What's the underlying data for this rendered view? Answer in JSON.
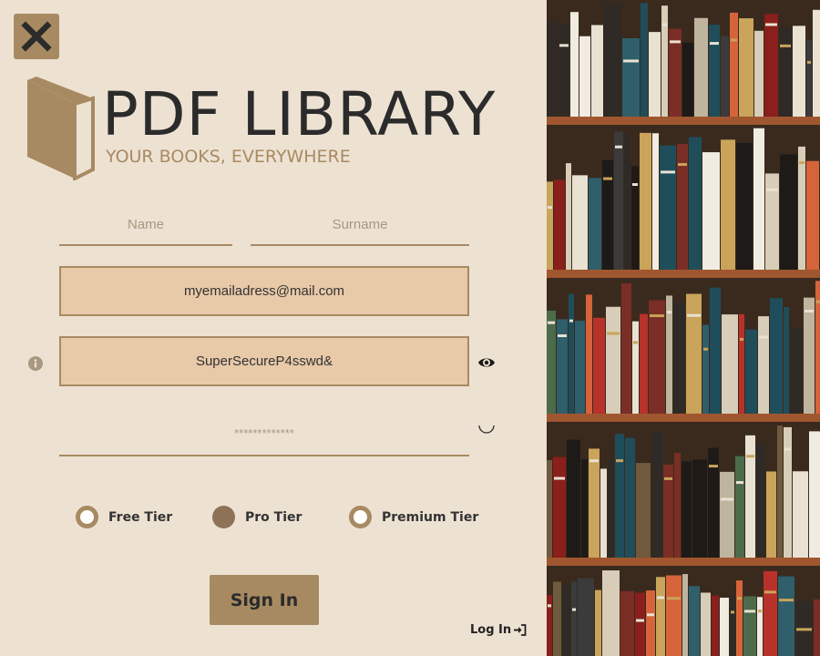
{
  "brand": {
    "title": "PDF LIBRARY",
    "tagline": "YOUR BOOKS, EVERYWHERE"
  },
  "form": {
    "name_placeholder": "Name",
    "surname_placeholder": "Surname",
    "email_value": "myemailadress@mail.com",
    "password_value": "SuperSecureP4sswd&",
    "confirm_placeholder": "*************",
    "tiers": [
      {
        "label": "Free Tier",
        "selected": false
      },
      {
        "label": "Pro Tier",
        "selected": true
      },
      {
        "label": "Premium Tier",
        "selected": false
      }
    ],
    "sign_in_label": "Sign In",
    "login_label": "Log In"
  },
  "icons": {
    "close": "close-icon",
    "logo": "book-icon",
    "info": "info-icon",
    "show_password": "eye-icon",
    "loading": "loading-arc-icon",
    "login": "login-arrow-icon"
  },
  "colors": {
    "background": "#ede2d2",
    "accent": "#a88a62",
    "input_fill": "#e8c9a8",
    "text_dark": "#2b2b2b",
    "selected_radio": "#8d7258"
  }
}
